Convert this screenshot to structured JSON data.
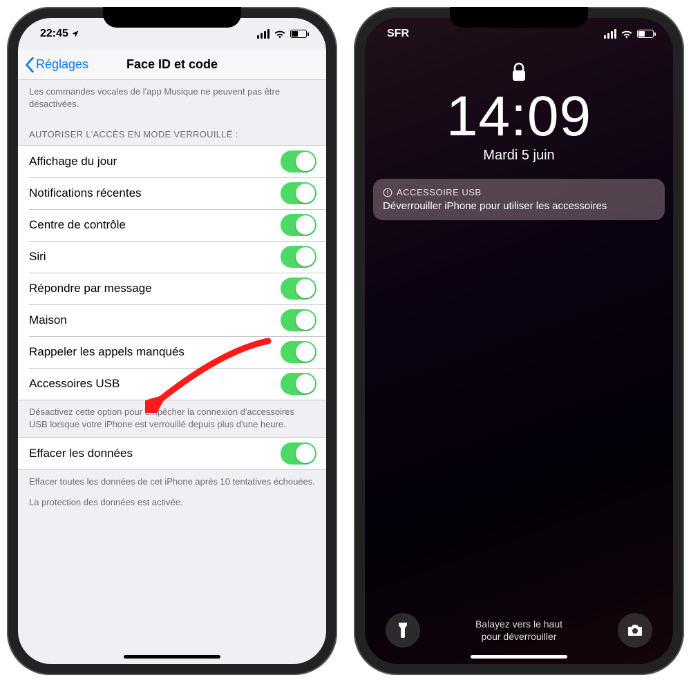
{
  "phone1": {
    "status": {
      "time": "22:45",
      "location_icon": "location-arrow"
    },
    "nav": {
      "back_label": "Réglages",
      "title": "Face ID et code"
    },
    "top_note": "Les commandes vocales de l'app Musique ne peuvent pas être désactivées.",
    "section_header": "AUTORISER L'ACCÈS EN MODE VERROUILLÉ :",
    "rows": [
      {
        "label": "Affichage du jour",
        "on": true
      },
      {
        "label": "Notifications récentes",
        "on": true
      },
      {
        "label": "Centre de contrôle",
        "on": true
      },
      {
        "label": "Siri",
        "on": true
      },
      {
        "label": "Répondre par message",
        "on": true
      },
      {
        "label": "Maison",
        "on": true
      },
      {
        "label": "Rappeler les appels manqués",
        "on": true
      },
      {
        "label": "Accessoires USB",
        "on": true
      }
    ],
    "usb_note": "Désactivez cette option pour empêcher la connexion d'accessoires USB lorsque votre iPhone est verrouillé depuis plus d'une heure.",
    "erase": {
      "label": "Effacer les données",
      "on": true
    },
    "erase_note1": "Effacer toutes les données de cet iPhone après 10 tentatives échouées.",
    "erase_note2": "La protection des données est activée."
  },
  "phone2": {
    "status": {
      "carrier": "SFR"
    },
    "lock": {
      "time": "14:09",
      "date": "Mardi 5 juin"
    },
    "notification": {
      "header": "ACCESSOIRE USB",
      "body": "Déverrouiller iPhone pour utiliser les accessoires"
    },
    "bottom_text_l1": "Balayez vers le haut",
    "bottom_text_l2": "pour déverrouiller"
  }
}
